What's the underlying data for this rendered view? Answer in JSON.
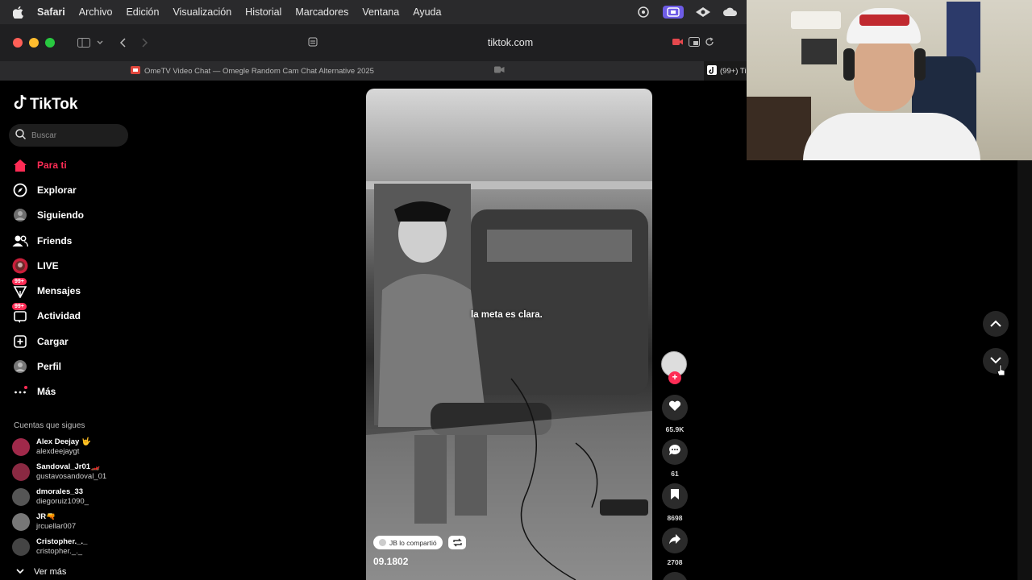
{
  "menubar": {
    "items": [
      "Safari",
      "Archivo",
      "Edición",
      "Visualización",
      "Historial",
      "Marcadores",
      "Ventana",
      "Ayuda"
    ]
  },
  "browser": {
    "url": "tiktok.com",
    "tabs": [
      {
        "label": "OmeTV Video Chat — Omegle Random Cam Chat Alternative 2025"
      },
      {
        "label": "(99+) Ti"
      }
    ]
  },
  "tiktok": {
    "logo": "TikTok",
    "search_placeholder": "Buscar",
    "nav": [
      {
        "label": "Para ti",
        "icon": "home-icon",
        "active": true
      },
      {
        "label": "Explorar",
        "icon": "compass-icon"
      },
      {
        "label": "Siguiendo",
        "icon": "following-avatar-icon"
      },
      {
        "label": "Friends",
        "icon": "friends-icon"
      },
      {
        "label": "LIVE",
        "icon": "live-icon"
      },
      {
        "label": "Mensajes",
        "icon": "message-icon",
        "badge": "99+"
      },
      {
        "label": "Actividad",
        "icon": "inbox-icon",
        "badge": "99+"
      },
      {
        "label": "Cargar",
        "icon": "upload-icon"
      },
      {
        "label": "Perfil",
        "icon": "profile-avatar-icon"
      },
      {
        "label": "Más",
        "icon": "more-icon"
      }
    ],
    "following_title": "Cuentas que sigues",
    "following": [
      {
        "name": "Alex Deejay 🤟",
        "handle": "alexdeejaygt"
      },
      {
        "name": "Sandoval_Jr01🏎️",
        "handle": "gustavosandoval_01"
      },
      {
        "name": "dmorales_33",
        "handle": "diegoruiz1090_"
      },
      {
        "name": "JR🔫",
        "handle": "jrcuellar007"
      },
      {
        "name": "Cristopher._._",
        "handle": "cristopher._._"
      }
    ],
    "see_more": "Ver más"
  },
  "video": {
    "caption": "la meta es clara.",
    "repost_label": "JB lo compartió",
    "title": "09.1802",
    "likes": "65.9K",
    "comments": "61",
    "saves": "8698",
    "shares": "2708"
  },
  "colors": {
    "accent": "#fe2c55",
    "menubar_bg": "#2a2a2c",
    "toolbar_bg": "#1f1f21"
  }
}
